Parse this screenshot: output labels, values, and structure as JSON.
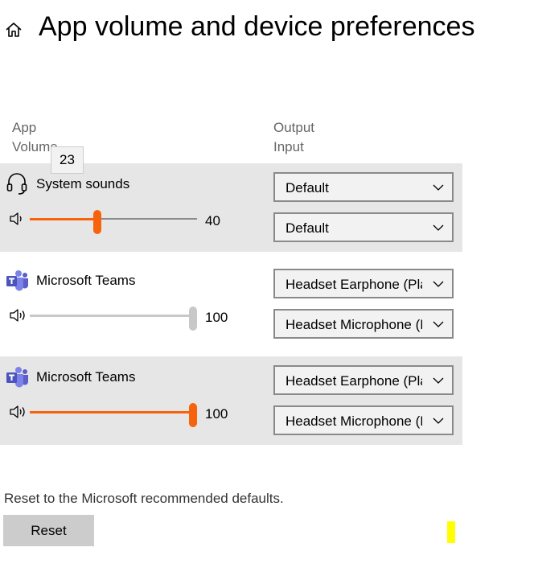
{
  "page": {
    "title": "App volume and device preferences"
  },
  "columns": {
    "app_line1": "App",
    "app_line2": "Volume",
    "device_line1": "Output",
    "device_line2": "Input"
  },
  "tooltip": "23",
  "apps": [
    {
      "name": "System sounds",
      "icon": "headset-icon",
      "volume": 40,
      "volume_label": "40",
      "volume_state": "active",
      "output": "Default",
      "input": "Default"
    },
    {
      "name": "Microsoft Teams",
      "icon": "teams-icon",
      "volume": 100,
      "volume_label": "100",
      "volume_state": "inactive",
      "output": "Headset Earphone (Plantronics",
      "input": "Headset Microphone (Plantronics"
    },
    {
      "name": "Microsoft Teams",
      "icon": "teams-icon",
      "volume": 100,
      "volume_label": "100",
      "volume_state": "active",
      "output": "Headset Earphone (Plantronics",
      "input": "Headset Microphone (Plantronics"
    }
  ],
  "reset": {
    "description": "Reset to the Microsoft recommended defaults.",
    "button_label": "Reset"
  },
  "colors": {
    "accent": "#f7630c",
    "inactive_track": "#c8c8c8",
    "track": "#8a8a8a",
    "row_shade": "#e6e6e6",
    "teams_purple": "#5b5fc7",
    "highlight_mark": "#ffff00"
  }
}
